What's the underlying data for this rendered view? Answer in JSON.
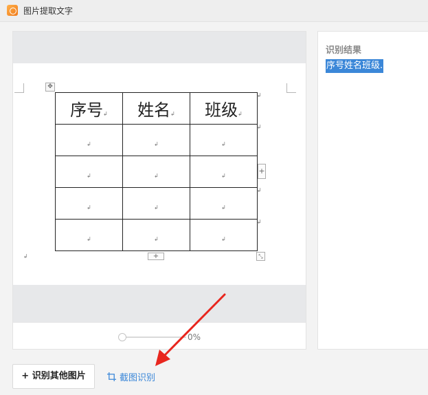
{
  "window": {
    "title": "图片提取文字"
  },
  "preview": {
    "table": [
      [
        "序号",
        "姓名",
        "班级"
      ],
      [
        "",
        "",
        ""
      ],
      [
        "",
        "",
        ""
      ],
      [
        "",
        "",
        ""
      ],
      [
        "",
        "",
        ""
      ]
    ],
    "zoom": "0%"
  },
  "result": {
    "title": "识别结果",
    "text": "序号姓名班级."
  },
  "actions": {
    "other_label": "+ 识别其他图片",
    "crop_label": "截图识别"
  },
  "colors": {
    "accent": "#3b87d8",
    "arrow": "#e8261e"
  }
}
